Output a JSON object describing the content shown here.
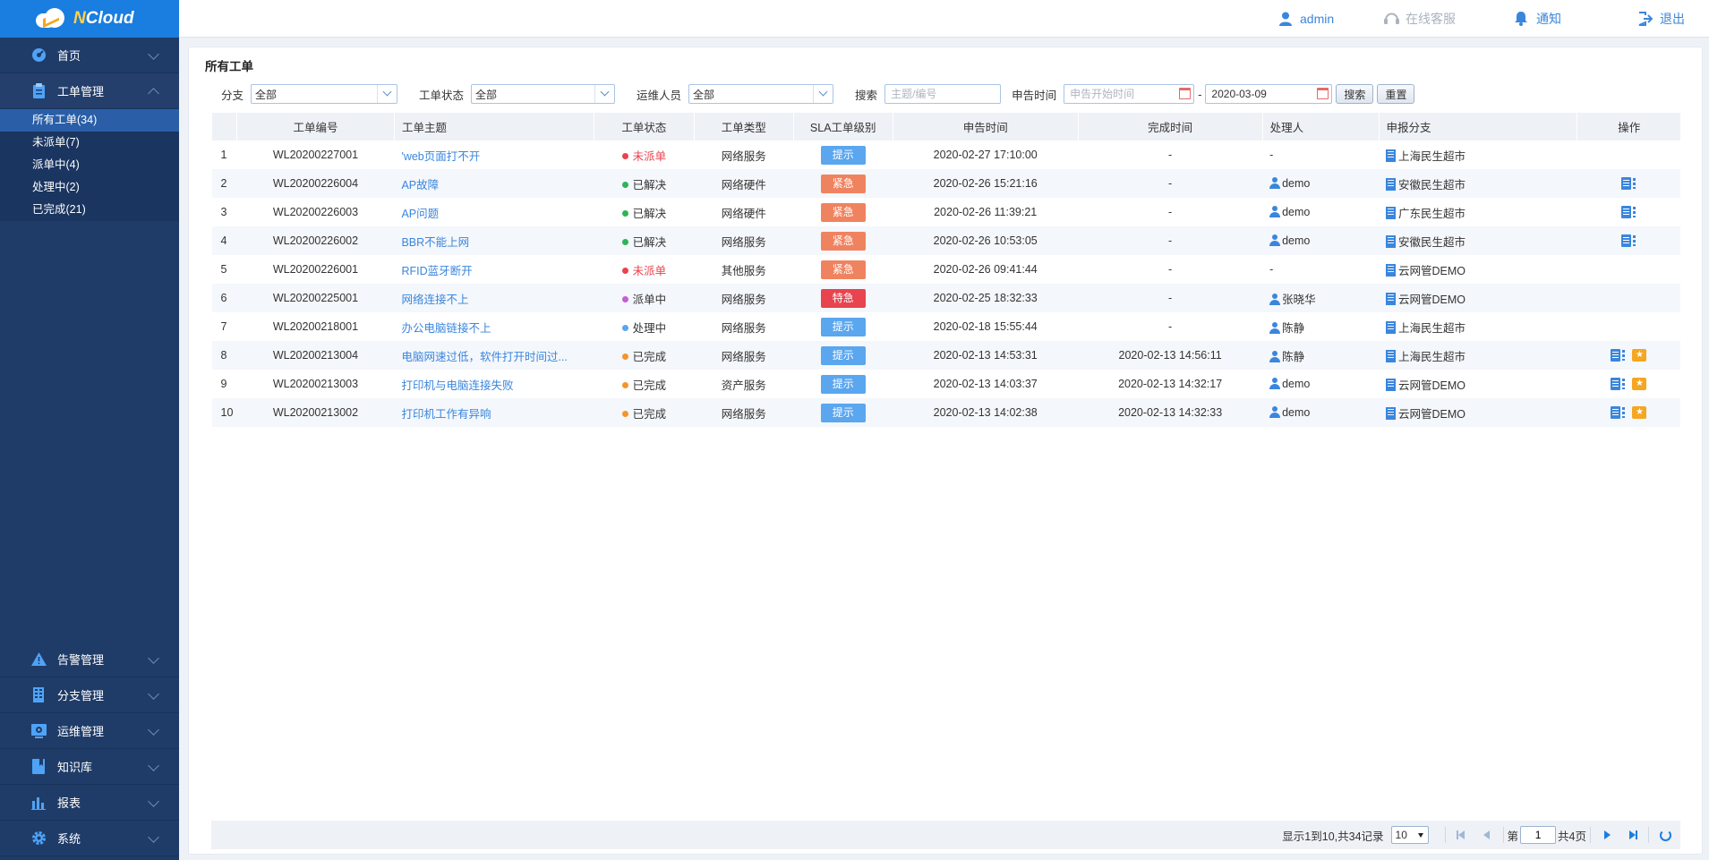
{
  "app": {
    "logo_text": "NCloud"
  },
  "sidebar": {
    "top_items": [
      {
        "label": "首页",
        "icon": "dashboard-icon"
      },
      {
        "label": "工单管理",
        "icon": "clipboard-icon"
      }
    ],
    "sub_items": [
      {
        "label": "所有工单(34)",
        "active": true
      },
      {
        "label": "未派单(7)"
      },
      {
        "label": "派单中(4)"
      },
      {
        "label": "处理中(2)"
      },
      {
        "label": "已完成(21)"
      }
    ],
    "bottom_items": [
      {
        "label": "告警管理",
        "icon": "warning-icon"
      },
      {
        "label": "分支管理",
        "icon": "building-icon"
      },
      {
        "label": "运维管理",
        "icon": "monitor-icon"
      },
      {
        "label": "知识库",
        "icon": "book-icon"
      },
      {
        "label": "报表",
        "icon": "bar-chart-icon"
      },
      {
        "label": "系统",
        "icon": "gear-icon"
      }
    ]
  },
  "topbar": {
    "user": "admin",
    "service": "在线客服",
    "notify": "通知",
    "logout": "退出"
  },
  "page": {
    "title": "所有工单"
  },
  "filters": {
    "branch_label": "分支",
    "branch_value": "全部",
    "status_label": "工单状态",
    "status_value": "全部",
    "staff_label": "运维人员",
    "staff_value": "全部",
    "search_label": "搜索",
    "search_placeholder": "主题/编号",
    "time_label": "申告时间",
    "start_placeholder": "申告开始时间",
    "dash": "-",
    "end_value": "2020-03-09",
    "search_button": "搜索",
    "reset_button": "重置"
  },
  "table": {
    "headers": [
      "",
      "工单编号",
      "工单主题",
      "工单状态",
      "工单类型",
      "SLA工单级别",
      "申告时间",
      "完成时间",
      "处理人",
      "申报分支",
      "操作"
    ],
    "rows": [
      {
        "idx": "1",
        "id": "WL20200227001",
        "subject": "'web页面打不开",
        "status": "未派单",
        "status_color": "#e8434e",
        "type": "网络服务",
        "sla": "提示",
        "sla_color": "#5aa6ef",
        "time": "2020-02-27 17:10:00",
        "done": "-",
        "handler": "-",
        "branch": "上海民生超市",
        "ops": 0
      },
      {
        "idx": "2",
        "id": "WL20200226004",
        "subject": "AP故障",
        "status": "已解决",
        "status_color": "#2db35a",
        "type": "网络硬件",
        "sla": "紧急",
        "sla_color": "#f0835f",
        "time": "2020-02-26 15:21:16",
        "done": "-",
        "handler": "demo",
        "branch": "安徽民生超市",
        "ops": 1
      },
      {
        "idx": "3",
        "id": "WL20200226003",
        "subject": "AP问题",
        "status": "已解决",
        "status_color": "#2db35a",
        "type": "网络硬件",
        "sla": "紧急",
        "sla_color": "#f0835f",
        "time": "2020-02-26 11:39:21",
        "done": "-",
        "handler": "demo",
        "branch": "广东民生超市",
        "ops": 1
      },
      {
        "idx": "4",
        "id": "WL20200226002",
        "subject": "BBR不能上网",
        "status": "已解决",
        "status_color": "#2db35a",
        "type": "网络服务",
        "sla": "紧急",
        "sla_color": "#f0835f",
        "time": "2020-02-26 10:53:05",
        "done": "-",
        "handler": "demo",
        "branch": "安徽民生超市",
        "ops": 1
      },
      {
        "idx": "5",
        "id": "WL20200226001",
        "subject": "RFID蓝牙断开",
        "status": "未派单",
        "status_color": "#e8434e",
        "type": "其他服务",
        "sla": "紧急",
        "sla_color": "#f0835f",
        "time": "2020-02-26 09:41:44",
        "done": "-",
        "handler": "-",
        "branch": "云网管DEMO",
        "ops": 0
      },
      {
        "idx": "6",
        "id": "WL20200225001",
        "subject": "网络连接不上",
        "status": "派单中",
        "status_color": "#c55ed8",
        "type": "网络服务",
        "sla": "特急",
        "sla_color": "#e8434e",
        "time": "2020-02-25 18:32:33",
        "done": "-",
        "handler": "张晓华",
        "branch": "云网管DEMO",
        "ops": 0
      },
      {
        "idx": "7",
        "id": "WL20200218001",
        "subject": "办公电脑链接不上",
        "status": "处理中",
        "status_color": "#5aa6ef",
        "type": "网络服务",
        "sla": "提示",
        "sla_color": "#5aa6ef",
        "time": "2020-02-18 15:55:44",
        "done": "-",
        "handler": "陈静",
        "branch": "上海民生超市",
        "ops": 0
      },
      {
        "idx": "8",
        "id": "WL20200213004",
        "subject": "电脑网速过低，软件打开时间过...",
        "status": "已完成",
        "status_color": "#f3962b",
        "type": "网络服务",
        "sla": "提示",
        "sla_color": "#5aa6ef",
        "time": "2020-02-13 14:53:31",
        "done": "2020-02-13 14:56:11",
        "handler": "陈静",
        "branch": "上海民生超市",
        "ops": 2
      },
      {
        "idx": "9",
        "id": "WL20200213003",
        "subject": "打印机与电脑连接失败",
        "status": "已完成",
        "status_color": "#f3962b",
        "type": "资产服务",
        "sla": "提示",
        "sla_color": "#5aa6ef",
        "time": "2020-02-13 14:03:37",
        "done": "2020-02-13 14:32:17",
        "handler": "demo",
        "branch": "云网管DEMO",
        "ops": 2
      },
      {
        "idx": "10",
        "id": "WL20200213002",
        "subject": "打印机工作有异响",
        "status": "已完成",
        "status_color": "#f3962b",
        "type": "网络服务",
        "sla": "提示",
        "sla_color": "#5aa6ef",
        "time": "2020-02-13 14:02:38",
        "done": "2020-02-13 14:32:33",
        "handler": "demo",
        "branch": "云网管DEMO",
        "ops": 2
      }
    ]
  },
  "pager": {
    "summary": "显示1到10,共34记录",
    "page_size": "10",
    "page_prefix": "第",
    "page_value": "1",
    "page_total": "共4页"
  }
}
